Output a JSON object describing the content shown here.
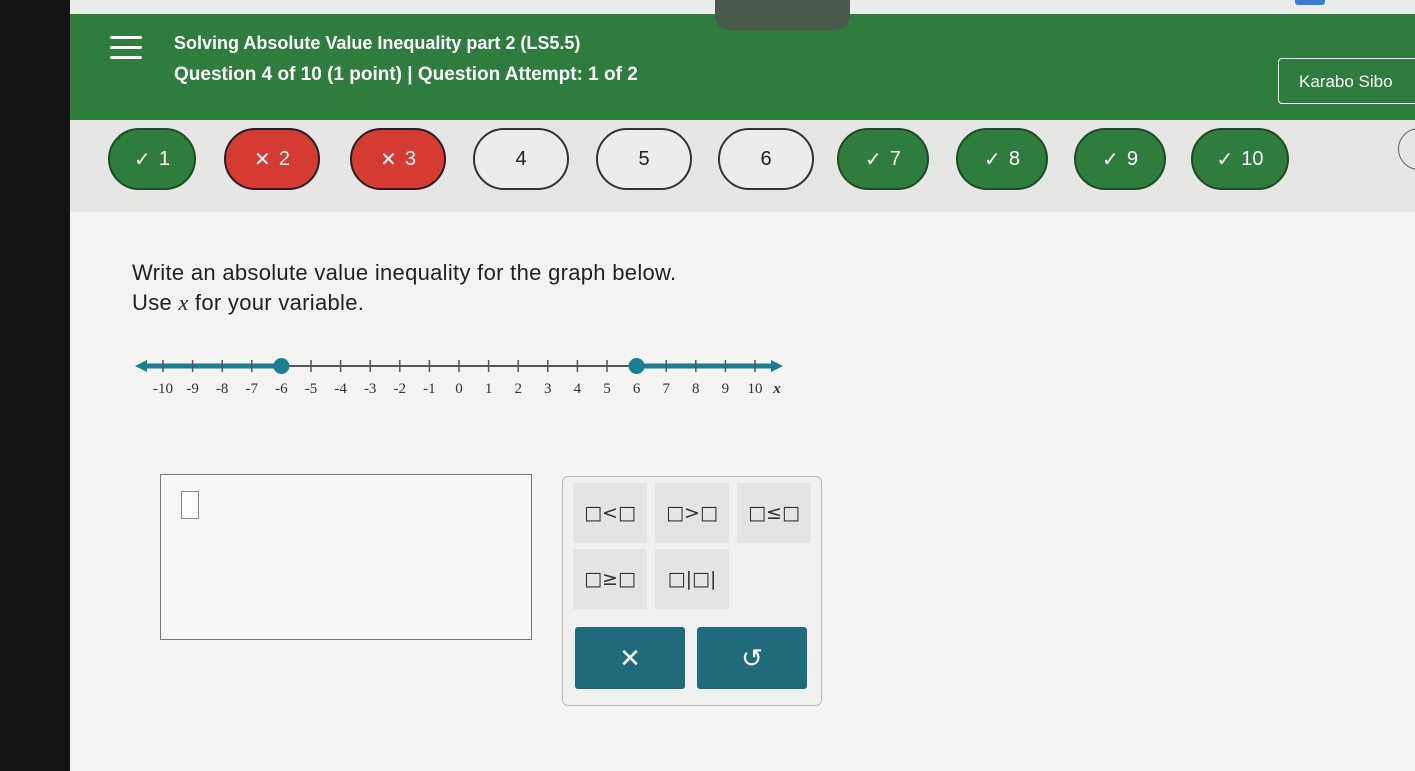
{
  "header": {
    "title": "Solving Absolute Value Inequality part 2 (LS5.5)",
    "subtitle": "Question 4 of 10 (1 point)  |  Question Attempt: 1 of 2",
    "user": "Karabo Sibo"
  },
  "questions": [
    {
      "label": "1",
      "status": "correct",
      "mark": "✓"
    },
    {
      "label": "2",
      "status": "wrong",
      "mark": "✕"
    },
    {
      "label": "3",
      "status": "wrong",
      "mark": "✕"
    },
    {
      "label": "4",
      "status": "current",
      "mark": ""
    },
    {
      "label": "5",
      "status": "unanswered",
      "mark": ""
    },
    {
      "label": "6",
      "status": "unanswered",
      "mark": ""
    },
    {
      "label": "7",
      "status": "correct",
      "mark": "✓"
    },
    {
      "label": "8",
      "status": "correct",
      "mark": "✓"
    },
    {
      "label": "9",
      "status": "correct",
      "mark": "✓"
    },
    {
      "label": "10",
      "status": "correct",
      "mark": "✓"
    }
  ],
  "prompt": {
    "line1": "Write an absolute value inequality for the graph below.",
    "line2_pre": "Use ",
    "line2_var": "x",
    "line2_post": " for your variable."
  },
  "number_line": {
    "tick_labels": [
      "-10",
      "-9",
      "-8",
      "-7",
      "-6",
      "-5",
      "-4",
      "-3",
      "-2",
      "-1",
      "0",
      "1",
      "2",
      "3",
      "4",
      "5",
      "6",
      "7",
      "8",
      "9",
      "10"
    ],
    "variable": "x",
    "closed_points": [
      -6,
      6
    ],
    "shaded_rays": [
      {
        "from": -6,
        "direction": "left"
      },
      {
        "from": 6,
        "direction": "right"
      }
    ],
    "accent_color": "#1a7f8e"
  },
  "keypad": {
    "row1": [
      "□<□",
      "□>□",
      "□≤□"
    ],
    "row2": [
      "□≥□",
      "□|□|"
    ],
    "clear": "✕",
    "undo": "↺"
  },
  "colors": {
    "header_green": "#2e7d3c",
    "wrong_red": "#d63b32",
    "action_teal": "#1f6b7c"
  }
}
